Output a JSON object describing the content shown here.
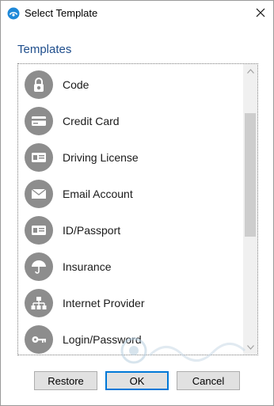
{
  "window": {
    "title": "Select Template",
    "accent_color": "#0078d7"
  },
  "section": {
    "label": "Templates"
  },
  "templates": [
    {
      "label": "Code",
      "icon": "lock-icon"
    },
    {
      "label": "Credit Card",
      "icon": "credit-card-icon"
    },
    {
      "label": "Driving License",
      "icon": "id-card-icon"
    },
    {
      "label": "Email Account",
      "icon": "envelope-icon"
    },
    {
      "label": "ID/Passport",
      "icon": "id-card-icon"
    },
    {
      "label": "Insurance",
      "icon": "umbrella-icon"
    },
    {
      "label": "Internet Provider",
      "icon": "network-icon"
    },
    {
      "label": "Login/Password",
      "icon": "key-icon"
    }
  ],
  "buttons": {
    "restore": "Restore",
    "ok": "OK",
    "cancel": "Cancel"
  }
}
